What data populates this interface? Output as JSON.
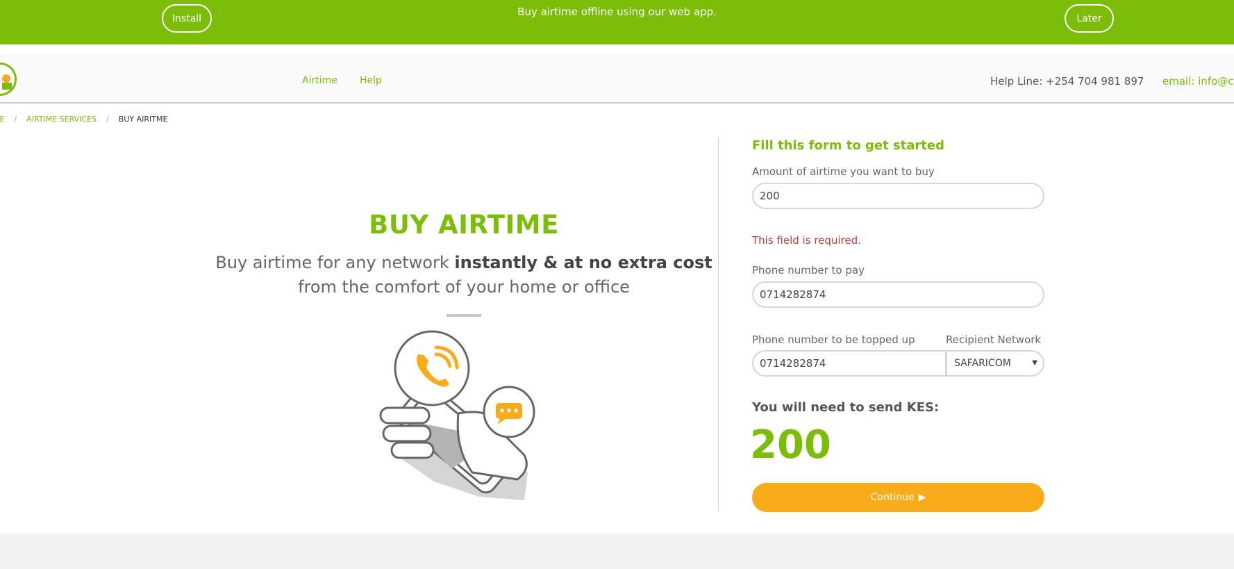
{
  "banner": {
    "install_label": "Install",
    "message": "Buy airtime offline using our web app.",
    "later_label": "Later"
  },
  "nav": {
    "links": [
      {
        "label": "Airtime"
      },
      {
        "label": "Help"
      }
    ],
    "helpline": "Help Line: +254 704 981 897",
    "email": "email: info@ch"
  },
  "breadcrumb": {
    "items": [
      "ME",
      "AIRTIME SERVICES",
      "BUY AIRITME"
    ],
    "separator": "/"
  },
  "hero": {
    "title": "BUY AIRTIME",
    "subtitle_part1": "Buy airtime for any network ",
    "subtitle_bold": "instantly & at no extra cost",
    "subtitle_part2": "from the comfort of your home or office"
  },
  "form": {
    "title": "Fill this form to get started",
    "amount_label": "Amount of airtime you want to buy",
    "amount_value": "200",
    "amount_error": "This field is required.",
    "pay_label": "Phone number to pay",
    "pay_value": "0714282874",
    "topup_label": "Phone number to be topped up",
    "topup_value": "0714282874",
    "network_label": "Recipient Network",
    "network_value": "SAFARICOM",
    "send_label": "You will need to send KES:",
    "send_amount": "200",
    "continue_label": "Continue"
  },
  "colors": {
    "brand_green": "#7bbd08",
    "accent_orange": "#f9ab1a",
    "error_red": "#c33c3c"
  }
}
